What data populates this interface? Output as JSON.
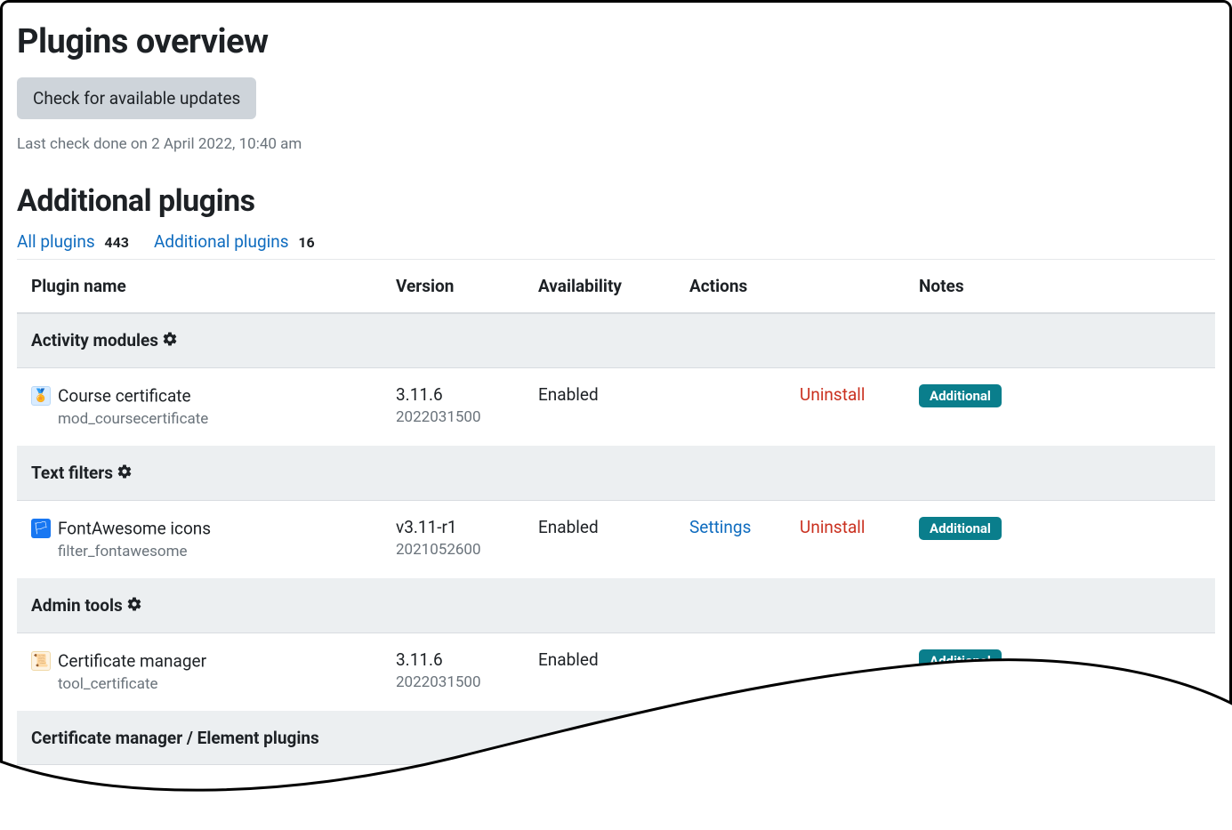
{
  "page_title": "Plugins overview",
  "check_button": "Check for available updates",
  "last_check": "Last check done on 2 April 2022, 10:40 am",
  "section_title": "Additional plugins",
  "tabs": {
    "all": {
      "label": "All plugins",
      "count": "443"
    },
    "additional": {
      "label": "Additional plugins",
      "count": "16"
    }
  },
  "columns": {
    "name": "Plugin name",
    "version": "Version",
    "availability": "Availability",
    "actions": "Actions",
    "notes": "Notes"
  },
  "labels": {
    "settings": "Settings",
    "uninstall": "Uninstall",
    "additional_badge": "Additional"
  },
  "categories": [
    {
      "title": "Activity modules",
      "has_gear": true,
      "plugins": [
        {
          "icon": "certificate",
          "name": "Course certificate",
          "tech": "mod_coursecertificate",
          "version": "3.11.6",
          "version_sub": "2022031500",
          "availability": "Enabled",
          "has_settings": false,
          "has_uninstall": true,
          "has_badge": true
        }
      ]
    },
    {
      "title": "Text filters",
      "has_gear": true,
      "plugins": [
        {
          "icon": "fontawesome",
          "name": "FontAwesome icons",
          "tech": "filter_fontawesome",
          "version": "v3.11-r1",
          "version_sub": "2021052600",
          "availability": "Enabled",
          "has_settings": true,
          "has_uninstall": true,
          "has_badge": true
        }
      ]
    },
    {
      "title": "Admin tools",
      "has_gear": true,
      "plugins": [
        {
          "icon": "certmanager",
          "name": "Certificate manager",
          "tech": "tool_certificate",
          "version": "3.11.6",
          "version_sub": "2022031500",
          "availability": "Enabled",
          "has_settings": false,
          "has_uninstall": false,
          "has_badge": true
        }
      ]
    },
    {
      "title": "Certificate manager / Element plugins",
      "has_gear": false,
      "plugins": []
    }
  ]
}
